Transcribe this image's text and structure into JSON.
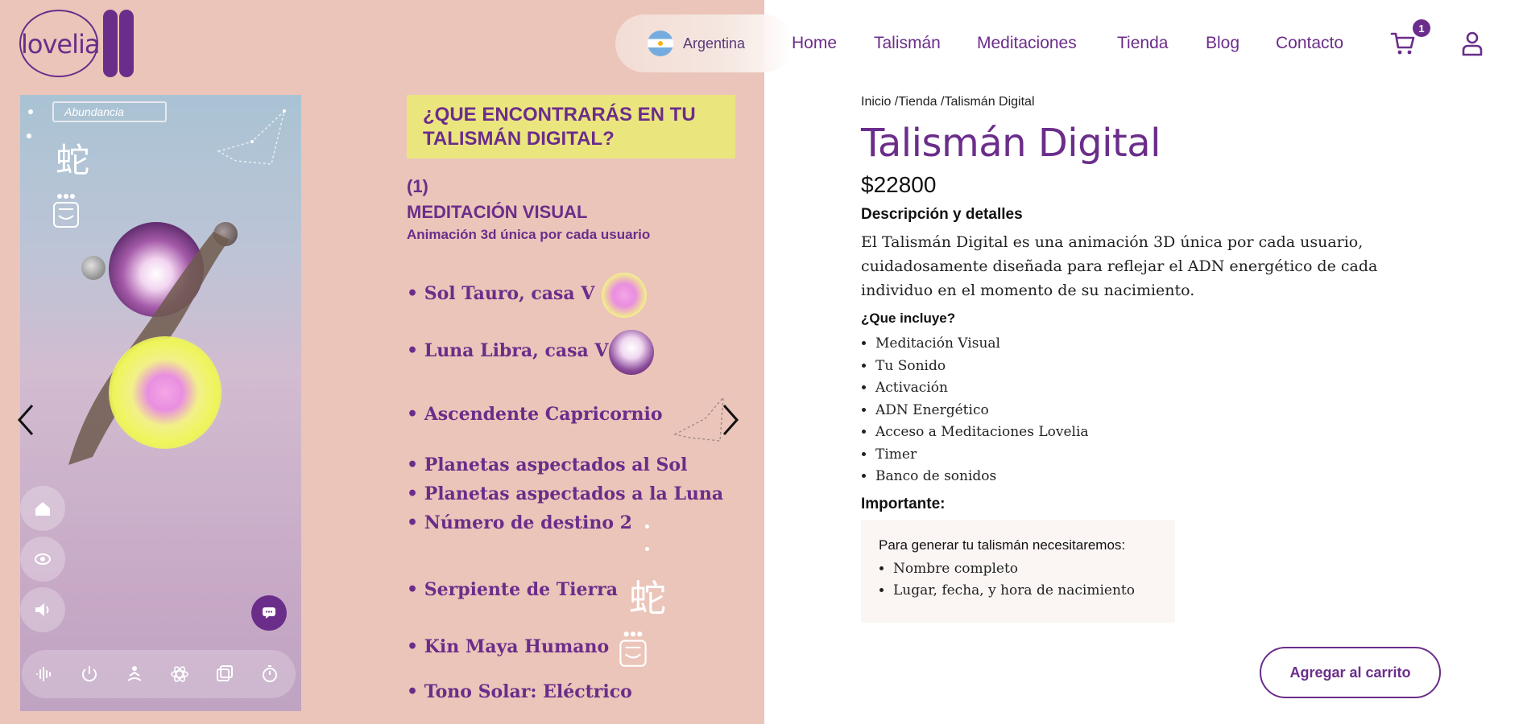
{
  "header": {
    "logo_text": "lovelia",
    "country": "Argentina",
    "nav": [
      "Home",
      "Talismán",
      "Meditaciones",
      "Tienda",
      "Blog",
      "Contacto"
    ],
    "cart_count": "1",
    "icons": {
      "cart": "cart-icon",
      "user": "user-icon"
    }
  },
  "preview": {
    "tag": "Abundancia",
    "kanji": "蛇",
    "controls": [
      "home-icon",
      "eye-icon",
      "volume-icon"
    ],
    "bottom_bar": [
      "waveform-icon",
      "power-icon",
      "meditation-icon",
      "atom-icon",
      "gallery-icon",
      "timer-icon"
    ],
    "chat_icon": "chat-icon"
  },
  "features": {
    "heading": "¿QUE ENCONTRARÁS EN TU TALISMÁN DIGITAL?",
    "number": "(1)",
    "title": "MEDITACIÓN VISUAL",
    "subtitle": "Animación 3d única por cada usuario",
    "items": [
      "• Sol Tauro, casa V",
      "• Luna Libra, casa V",
      "• Ascendente Capricornio",
      "• Planetas aspectados al Sol",
      "• Planetas aspectados a la Luna",
      "• Número de destino 2",
      "• Serpiente de Tierra",
      "• Kin Maya Humano",
      "• Tono Solar: Eléctrico"
    ]
  },
  "product": {
    "breadcrumb": "Inicio /Tienda /Talismán Digital",
    "title": "Talismán Digital",
    "price": "$22800",
    "description_heading": "Descripción y detalles",
    "description": "El Talismán Digital es una animación 3D única por cada usuario, cuidadosamente diseñada para reflejar el ADN energético de cada individuo en el momento de su nacimiento.",
    "includes_heading": "¿Que incluye?",
    "includes": [
      "Meditación Visual",
      "Tu Sonido",
      "Activación",
      "ADN Energético",
      "Acceso a Meditaciones Lovelia",
      "Timer",
      "Banco de sonidos"
    ],
    "important_heading": "Importante:",
    "requirements_heading": "Para generar tu talismán necesitaremos:",
    "requirements": [
      "Nombre completo",
      "Lugar, fecha, y hora de nacimiento"
    ],
    "add_to_cart": "Agregar al carrito"
  },
  "colors": {
    "brand": "#6b2d8a",
    "panel": "#ebc5b9",
    "highlight": "#ebe57e"
  }
}
